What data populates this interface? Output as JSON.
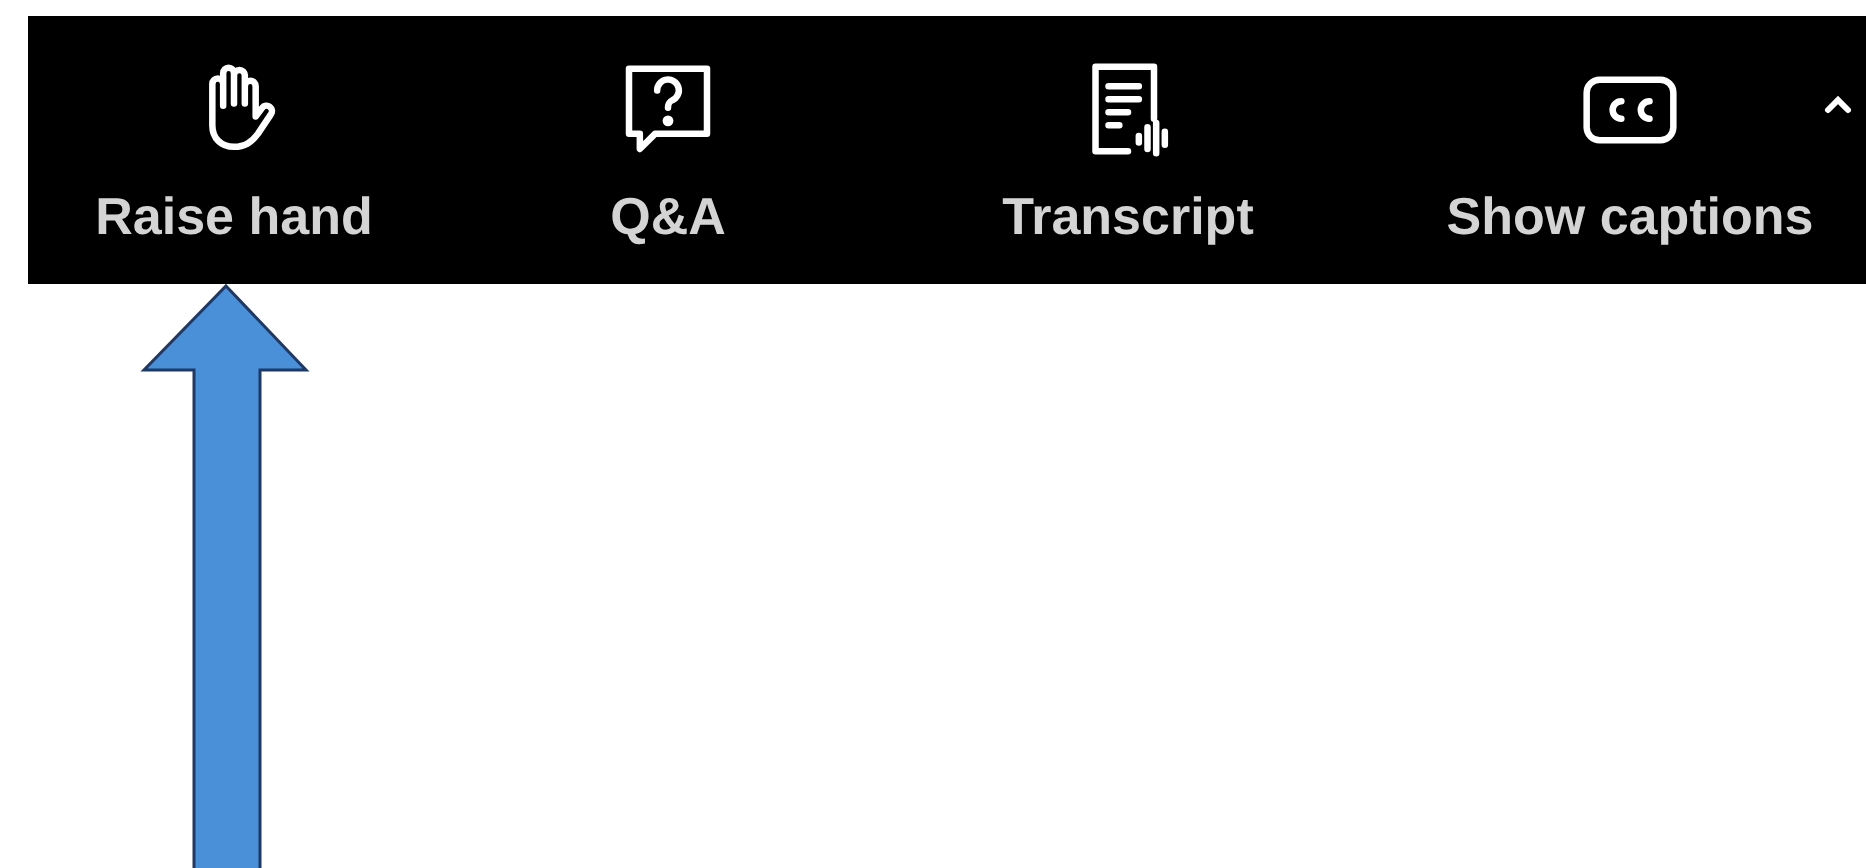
{
  "toolbar": {
    "buttons": [
      {
        "kind": "hand",
        "label": "Raise hand"
      },
      {
        "kind": "question",
        "label": "Q&A"
      },
      {
        "kind": "transcript",
        "label": "Transcript"
      },
      {
        "kind": "captions",
        "label": "Show captions"
      }
    ]
  }
}
